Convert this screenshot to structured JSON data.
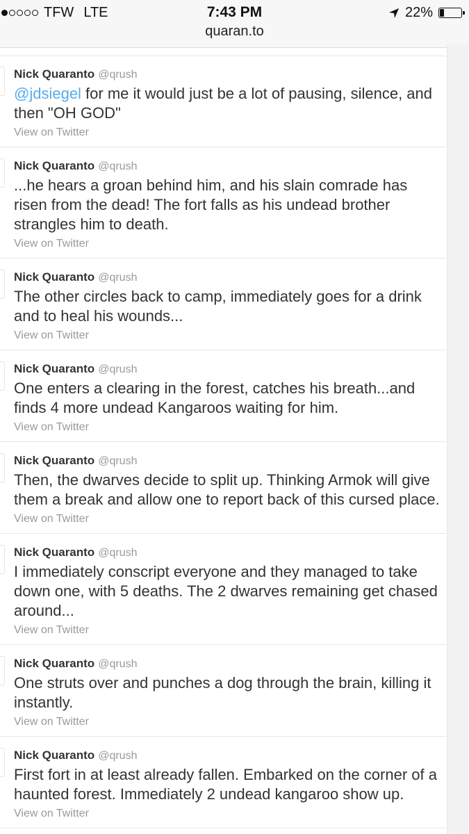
{
  "statusbar": {
    "carrier": "TFW",
    "network": "LTE",
    "time": "7:43 PM",
    "url": "quaran.to",
    "battery": "22%",
    "battery_level": 0.22,
    "signal_bars": 1
  },
  "tweets": [
    {
      "name": "Nick Quaranto",
      "handle": "@qrush",
      "mention": "@jdsiegel",
      "text": " for me it would just be a lot of pausing, silence, and then \"OH GOD\"",
      "link": "View on Twitter"
    },
    {
      "name": "Nick Quaranto",
      "handle": "@qrush",
      "mention": "",
      "text": "...he hears a groan behind him, and his slain comrade has risen from the dead! The fort falls as his undead brother strangles him to death.",
      "link": "View on Twitter"
    },
    {
      "name": "Nick Quaranto",
      "handle": "@qrush",
      "mention": "",
      "text": "The other circles back to camp, immediately goes for a drink and to heal his wounds...",
      "link": "View on Twitter"
    },
    {
      "name": "Nick Quaranto",
      "handle": "@qrush",
      "mention": "",
      "text": "One enters a clearing in the forest, catches his breath...and finds 4 more undead Kangaroos waiting for him.",
      "link": "View on Twitter"
    },
    {
      "name": "Nick Quaranto",
      "handle": "@qrush",
      "mention": "",
      "text": "Then, the dwarves decide to split up. Thinking Armok will give them a break and allow one to report back of this cursed place.",
      "link": "View on Twitter"
    },
    {
      "name": "Nick Quaranto",
      "handle": "@qrush",
      "mention": "",
      "text": "I immediately conscript everyone and they managed to take down one, with 5 deaths. The 2 dwarves remaining get chased around...",
      "link": "View on Twitter"
    },
    {
      "name": "Nick Quaranto",
      "handle": "@qrush",
      "mention": "",
      "text": "One struts over and punches a dog through the brain, killing it instantly.",
      "link": "View on Twitter"
    },
    {
      "name": "Nick Quaranto",
      "handle": "@qrush",
      "mention": "",
      "text": "First fort in at least already fallen. Embarked on the corner of a haunted forest. Immediately 2 undead kangaroo show up.",
      "link": "View on Twitter"
    }
  ]
}
